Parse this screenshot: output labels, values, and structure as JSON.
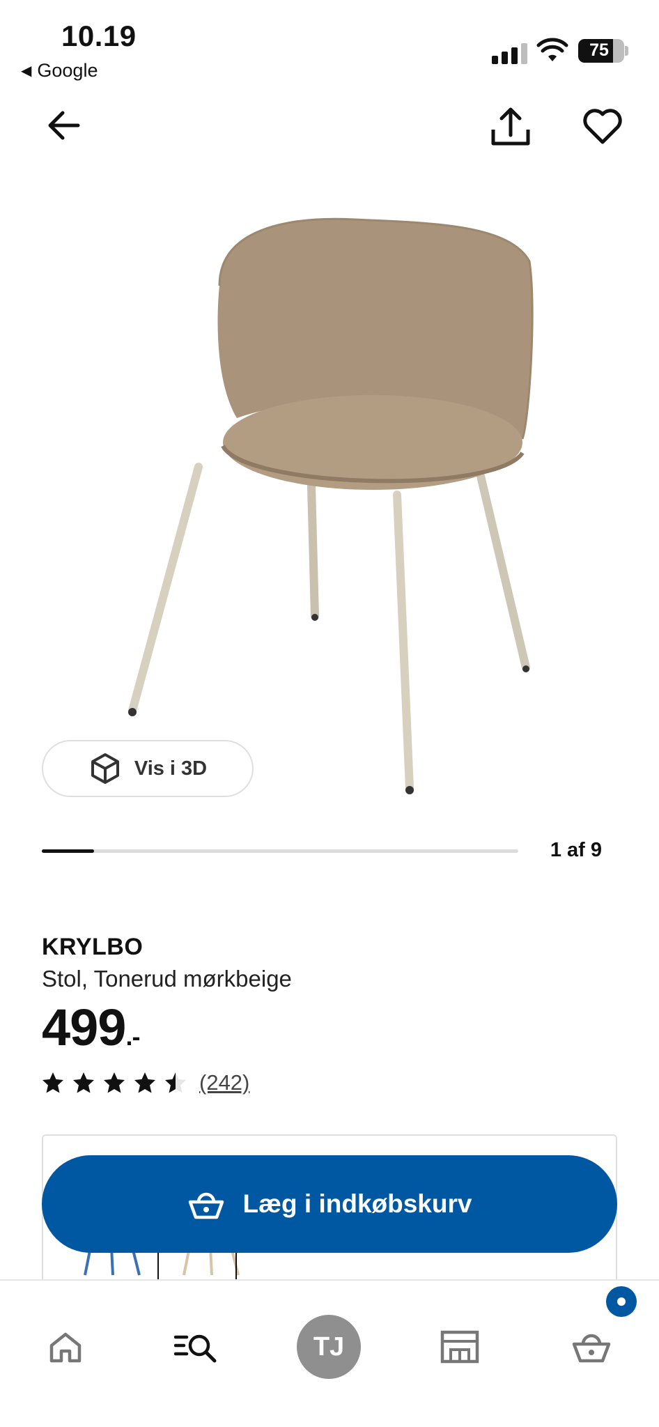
{
  "status_bar": {
    "time": "10.19",
    "back_app": "Google",
    "battery": "75"
  },
  "nav": {
    "back_icon": "arrow-left-icon",
    "share_icon": "share-icon",
    "favorite_icon": "heart-icon"
  },
  "gallery": {
    "view_3d_label": "Vis i 3D",
    "view_3d_icon": "cube-icon",
    "position_label": "1 af 9",
    "progress": 0.11
  },
  "product": {
    "name": "KRYLBO",
    "description": "Stol, Tonerud mørkbeige",
    "price": "499",
    "price_suffix": ".-",
    "rating_value": 4.5,
    "rating_max": 5,
    "review_count": "(242)"
  },
  "actions": {
    "add_to_cart_label": "Læg i indkøbskurv",
    "add_to_cart_icon": "basket-icon"
  },
  "tabbar": {
    "home_icon": "home-icon",
    "search_icon": "search-list-icon",
    "avatar_initials": "TJ",
    "store_icon": "store-icon",
    "cart_icon": "basket-icon"
  },
  "colors": {
    "accent": "#0058a3",
    "chair_fabric": "#a9937a",
    "chair_legs": "#cfc7b6"
  }
}
